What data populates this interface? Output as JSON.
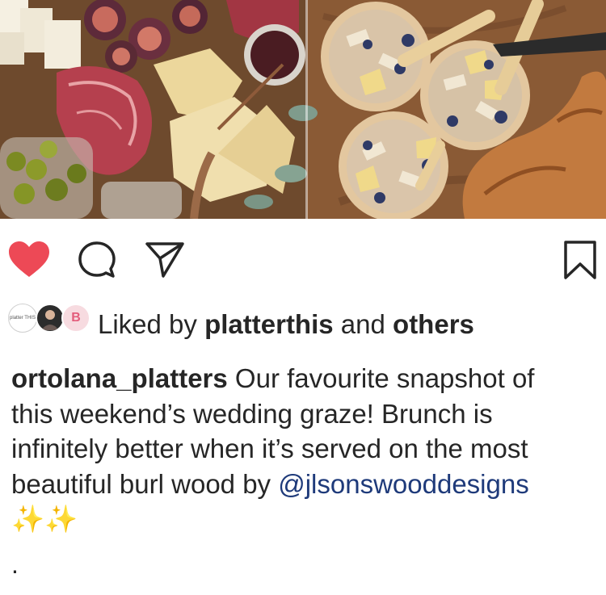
{
  "post": {
    "liked_by_prefix": "Liked by",
    "liked_by_user": "platterthis",
    "liked_by_joiner": "and",
    "liked_by_suffix": "others",
    "avatars": [
      {
        "name": "platterthis",
        "label": "platter THIS"
      },
      {
        "name": "person-avatar"
      },
      {
        "name": "pink-logo-avatar",
        "label": "B"
      }
    ],
    "caption": {
      "username": "ortolana_platters",
      "text_before_mention": "Our favourite snapshot of this weekend’s wedding graze! Brunch is infinitely better when it’s served on the most beautiful burl wood by",
      "mention": "@jlsonswooddesigns",
      "emoji": "✨✨",
      "trailing": "."
    }
  },
  "actions": {
    "like": {
      "icon": "heart-icon",
      "state": "liked",
      "color": "#ed4956"
    },
    "comment": {
      "icon": "comment-icon"
    },
    "share": {
      "icon": "send-icon"
    },
    "save": {
      "icon": "bookmark-icon"
    }
  },
  "colors": {
    "text": "#262626",
    "mention": "#1e3a7a",
    "like": "#ed4956"
  }
}
